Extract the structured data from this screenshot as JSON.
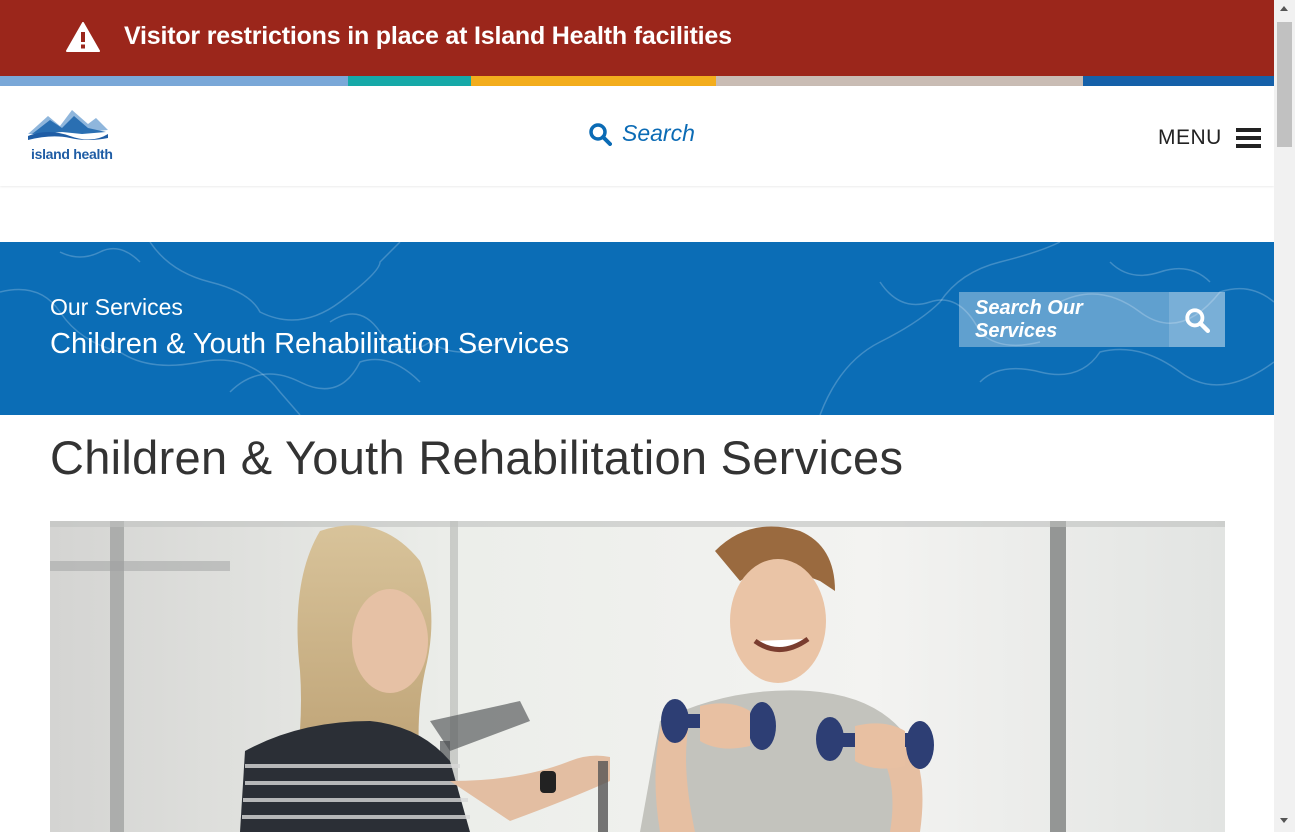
{
  "alert": {
    "text": "Visitor restrictions in place at Island Health facilities",
    "icon": "warning-icon",
    "background": "#9b261b"
  },
  "color_strip": [
    "#7aa8d8",
    "#16a9a8",
    "#f3ad1d",
    "#c9bcb4",
    "#1560a9"
  ],
  "header": {
    "logo_text": "island health",
    "search_label": "Search",
    "menu_label": "MENU"
  },
  "banner": {
    "breadcrumb": "Our Services",
    "title": "Children & Youth Rehabilitation Services",
    "search_placeholder": "Search Our Services",
    "background": "#0b6db6"
  },
  "main": {
    "heading": "Children & Youth Rehabilitation Services"
  },
  "colors": {
    "link_blue": "#0b6bb5",
    "text_dark": "#333333"
  }
}
